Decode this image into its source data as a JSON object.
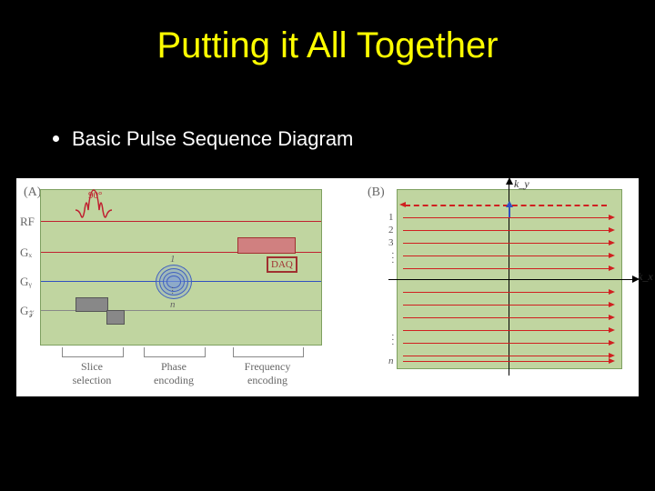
{
  "title": "Putting it All Together",
  "bullet": "Basic Pulse Sequence Diagram",
  "panelA": {
    "tag": "(A)",
    "rows": {
      "rf": "RF",
      "gx": "Gₓ",
      "gy": "Gᵧ",
      "gz": "G𝓏"
    },
    "rfAngle": "90°",
    "daq": "DAQ",
    "phaseTop": "1",
    "phaseBottom": "n",
    "brackets": {
      "slice": "Slice\nselection",
      "phase": "Phase\nencoding",
      "freq": "Frequency\nencoding"
    }
  },
  "panelB": {
    "tag": "(B)",
    "ky": "k_y",
    "kx": "k_x",
    "lineNums": {
      "l1": "1",
      "l2": "2",
      "l3": "3",
      "ln": "n"
    },
    "dots": "·"
  },
  "colors": {
    "rf": "#c02030",
    "gx": "#c02030",
    "gy": "#3050c0",
    "gz": "#888888",
    "kline": "#d02020"
  }
}
